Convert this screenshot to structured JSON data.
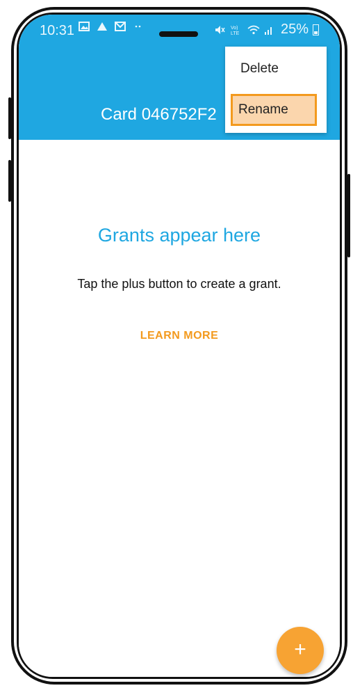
{
  "status_bar": {
    "time": "10:31",
    "left_icons": [
      "image-icon",
      "alert-icon",
      "mail-icon",
      "more-dots-icon"
    ],
    "right_icons": [
      "mute-icon",
      "volte-icon",
      "wifi-icon",
      "signal-icon"
    ],
    "volte_text": "VoLTE",
    "battery": "25%"
  },
  "app_bar": {
    "title": "Card 046752F2",
    "background_color": "#1fa7e1"
  },
  "overflow_menu": {
    "items": [
      {
        "label": "Delete"
      },
      {
        "label": "Rename",
        "highlighted": true
      }
    ],
    "highlight_color": "#f39a1e"
  },
  "empty_state": {
    "title": "Grants appear here",
    "subtitle": "Tap the plus button to create a grant.",
    "learn_more": "LEARN MORE"
  },
  "fab": {
    "icon": "plus-icon",
    "label": "+",
    "color": "#f7a333"
  }
}
